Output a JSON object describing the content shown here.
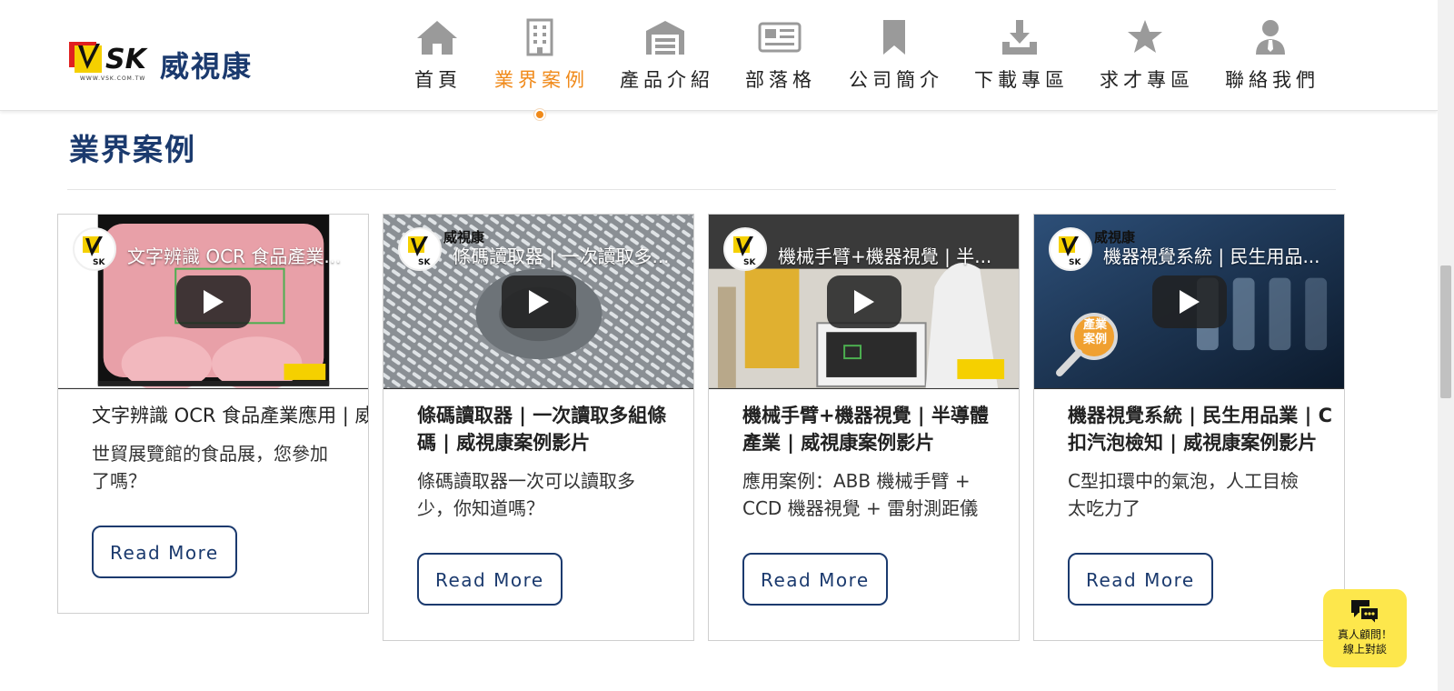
{
  "brand": {
    "name_cn": "威視康",
    "logo_text": "SK",
    "logo_url_text": "WWW.VSK.COM.TW"
  },
  "nav": {
    "items": [
      {
        "label": "首頁",
        "icon": "home-icon"
      },
      {
        "label": "業界案例",
        "icon": "building-icon",
        "active": true
      },
      {
        "label": "產品介紹",
        "icon": "warehouse-icon"
      },
      {
        "label": "部落格",
        "icon": "newspaper-icon"
      },
      {
        "label": "公司簡介",
        "icon": "bookmark-icon"
      },
      {
        "label": "下載專區",
        "icon": "download-icon"
      },
      {
        "label": "求才專區",
        "icon": "star-icon"
      },
      {
        "label": "聯絡我們",
        "icon": "person-icon"
      }
    ]
  },
  "section": {
    "title": "業界案例"
  },
  "cards": [
    {
      "video_title": "文字辨識 OCR 食品產業...",
      "channel": "",
      "heading": "文字辨識 OCR 食品產業應用 | 威",
      "desc": "世貿展覽館的食品展，您參加\n了嗎？",
      "button": "Read More"
    },
    {
      "video_title": "條碼讀取器 | 一次讀取多...",
      "channel": "威視康",
      "heading": "條碼讀取器 | 一次讀取多組條\n碼 | 威視康案例影片",
      "desc": "條碼讀取器一次可以讀取多\n少，你知道嗎？",
      "button": "Read More"
    },
    {
      "video_title": "機械手臂+機器視覺 | 半...",
      "channel": "",
      "heading": "機械手臂+機器視覺 | 半導體\n產業 | 威視康案例影片",
      "desc": "應用案例：ABB 機械手臂 +\nCCD 機器視覺 + 雷射測距儀",
      "button": "Read More"
    },
    {
      "video_title": "機器視覺系統 | 民生用品...",
      "channel": "威視康",
      "badge": "產業\n案例",
      "heading": "機器視覺系統 | 民生用品業 | C\n扣汽泡檢知 | 威視康案例影片",
      "desc": "C型扣環中的氣泡，人工目檢\n太吃力了",
      "button": "Read More"
    }
  ],
  "chat": {
    "label": "真人顧問！\n線上對談",
    "icon": "chat-bubbles-icon"
  },
  "colors": {
    "brand_navy": "#1b3a6e",
    "accent_orange": "#f08a1a",
    "chat_yellow": "#fde74c"
  }
}
